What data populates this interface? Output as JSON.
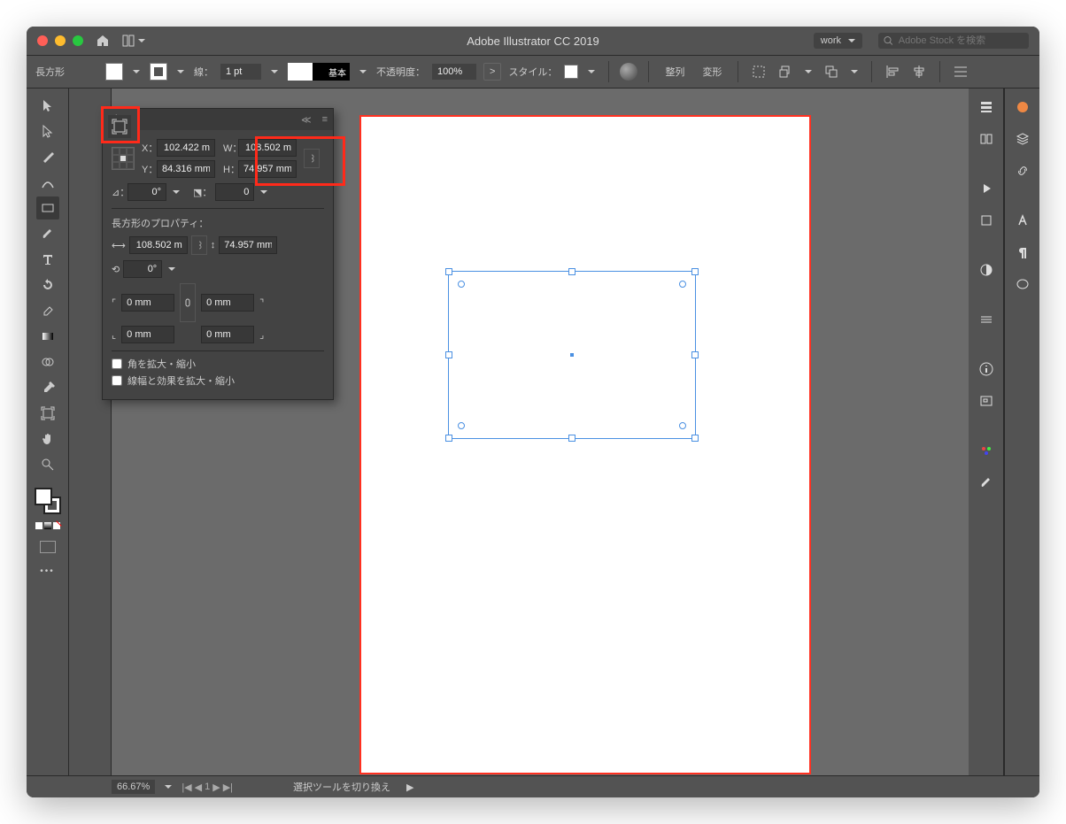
{
  "app_title": "Adobe Illustrator CC 2019",
  "workspace": "work",
  "search_placeholder": "Adobe Stock を検索",
  "control_bar": {
    "shape_label": "長方形",
    "stroke_label": "線：",
    "stroke_weight": "1 pt",
    "stroke_style_label": "基本",
    "opacity_label": "不透明度：",
    "opacity_value": "100%",
    "style_label": "スタイル：",
    "align_label": "整列",
    "transform_label": "変形"
  },
  "transform_panel": {
    "tab": "変形",
    "x_label": "X：",
    "x_value": "102.422 m",
    "y_label": "Y：",
    "y_value": "84.316 mm",
    "w_label": "W：",
    "w_value": "108.502 m",
    "h_label": "H：",
    "h_value": "74.957 mm",
    "angle_label": "⊿：",
    "angle_value": "0°",
    "shear_value": "0",
    "section_header": "長方形のプロパティ：",
    "rect_w": "108.502 m",
    "rect_h": "74.957 mm",
    "rect_angle": "0°",
    "corner_tl": "0 mm",
    "corner_tr": "0 mm",
    "corner_bl": "0 mm",
    "corner_br": "0 mm",
    "check_scale_corners": "角を拡大・縮小",
    "check_scale_strokes": "線幅と効果を拡大・縮小"
  },
  "statusbar": {
    "zoom": "66.67%",
    "artboard": "1",
    "status": "選択ツールを切り換え"
  }
}
